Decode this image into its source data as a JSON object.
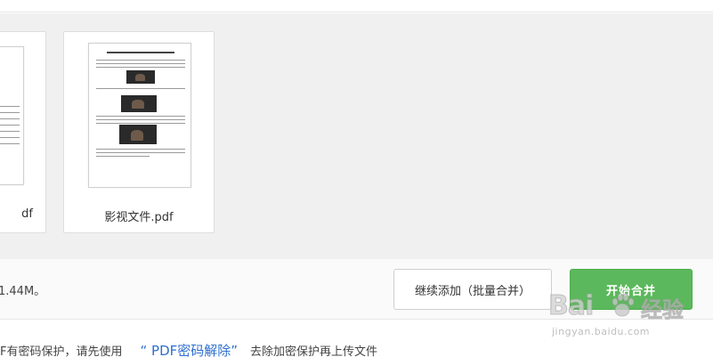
{
  "files": [
    {
      "name": "df"
    },
    {
      "name": "影视文件.pdf"
    }
  ],
  "action_bar": {
    "size_text": "1.44M。",
    "add_button": "继续添加（批量合并）",
    "merge_button": "开始合并"
  },
  "notice": {
    "prefix": "F有密码保护，请先使用",
    "link": "“ PDF密码解除”",
    "suffix": "去除加密保护再上传文件"
  },
  "watermark": {
    "logo": "Bai",
    "logo_cn": "经验",
    "url": "jingyan.baidu.com",
    "icon": "paw-icon"
  },
  "colors": {
    "merge_button": "#5cb85c",
    "link": "#2e6fcf",
    "file_area_bg": "#f0f0f0"
  }
}
